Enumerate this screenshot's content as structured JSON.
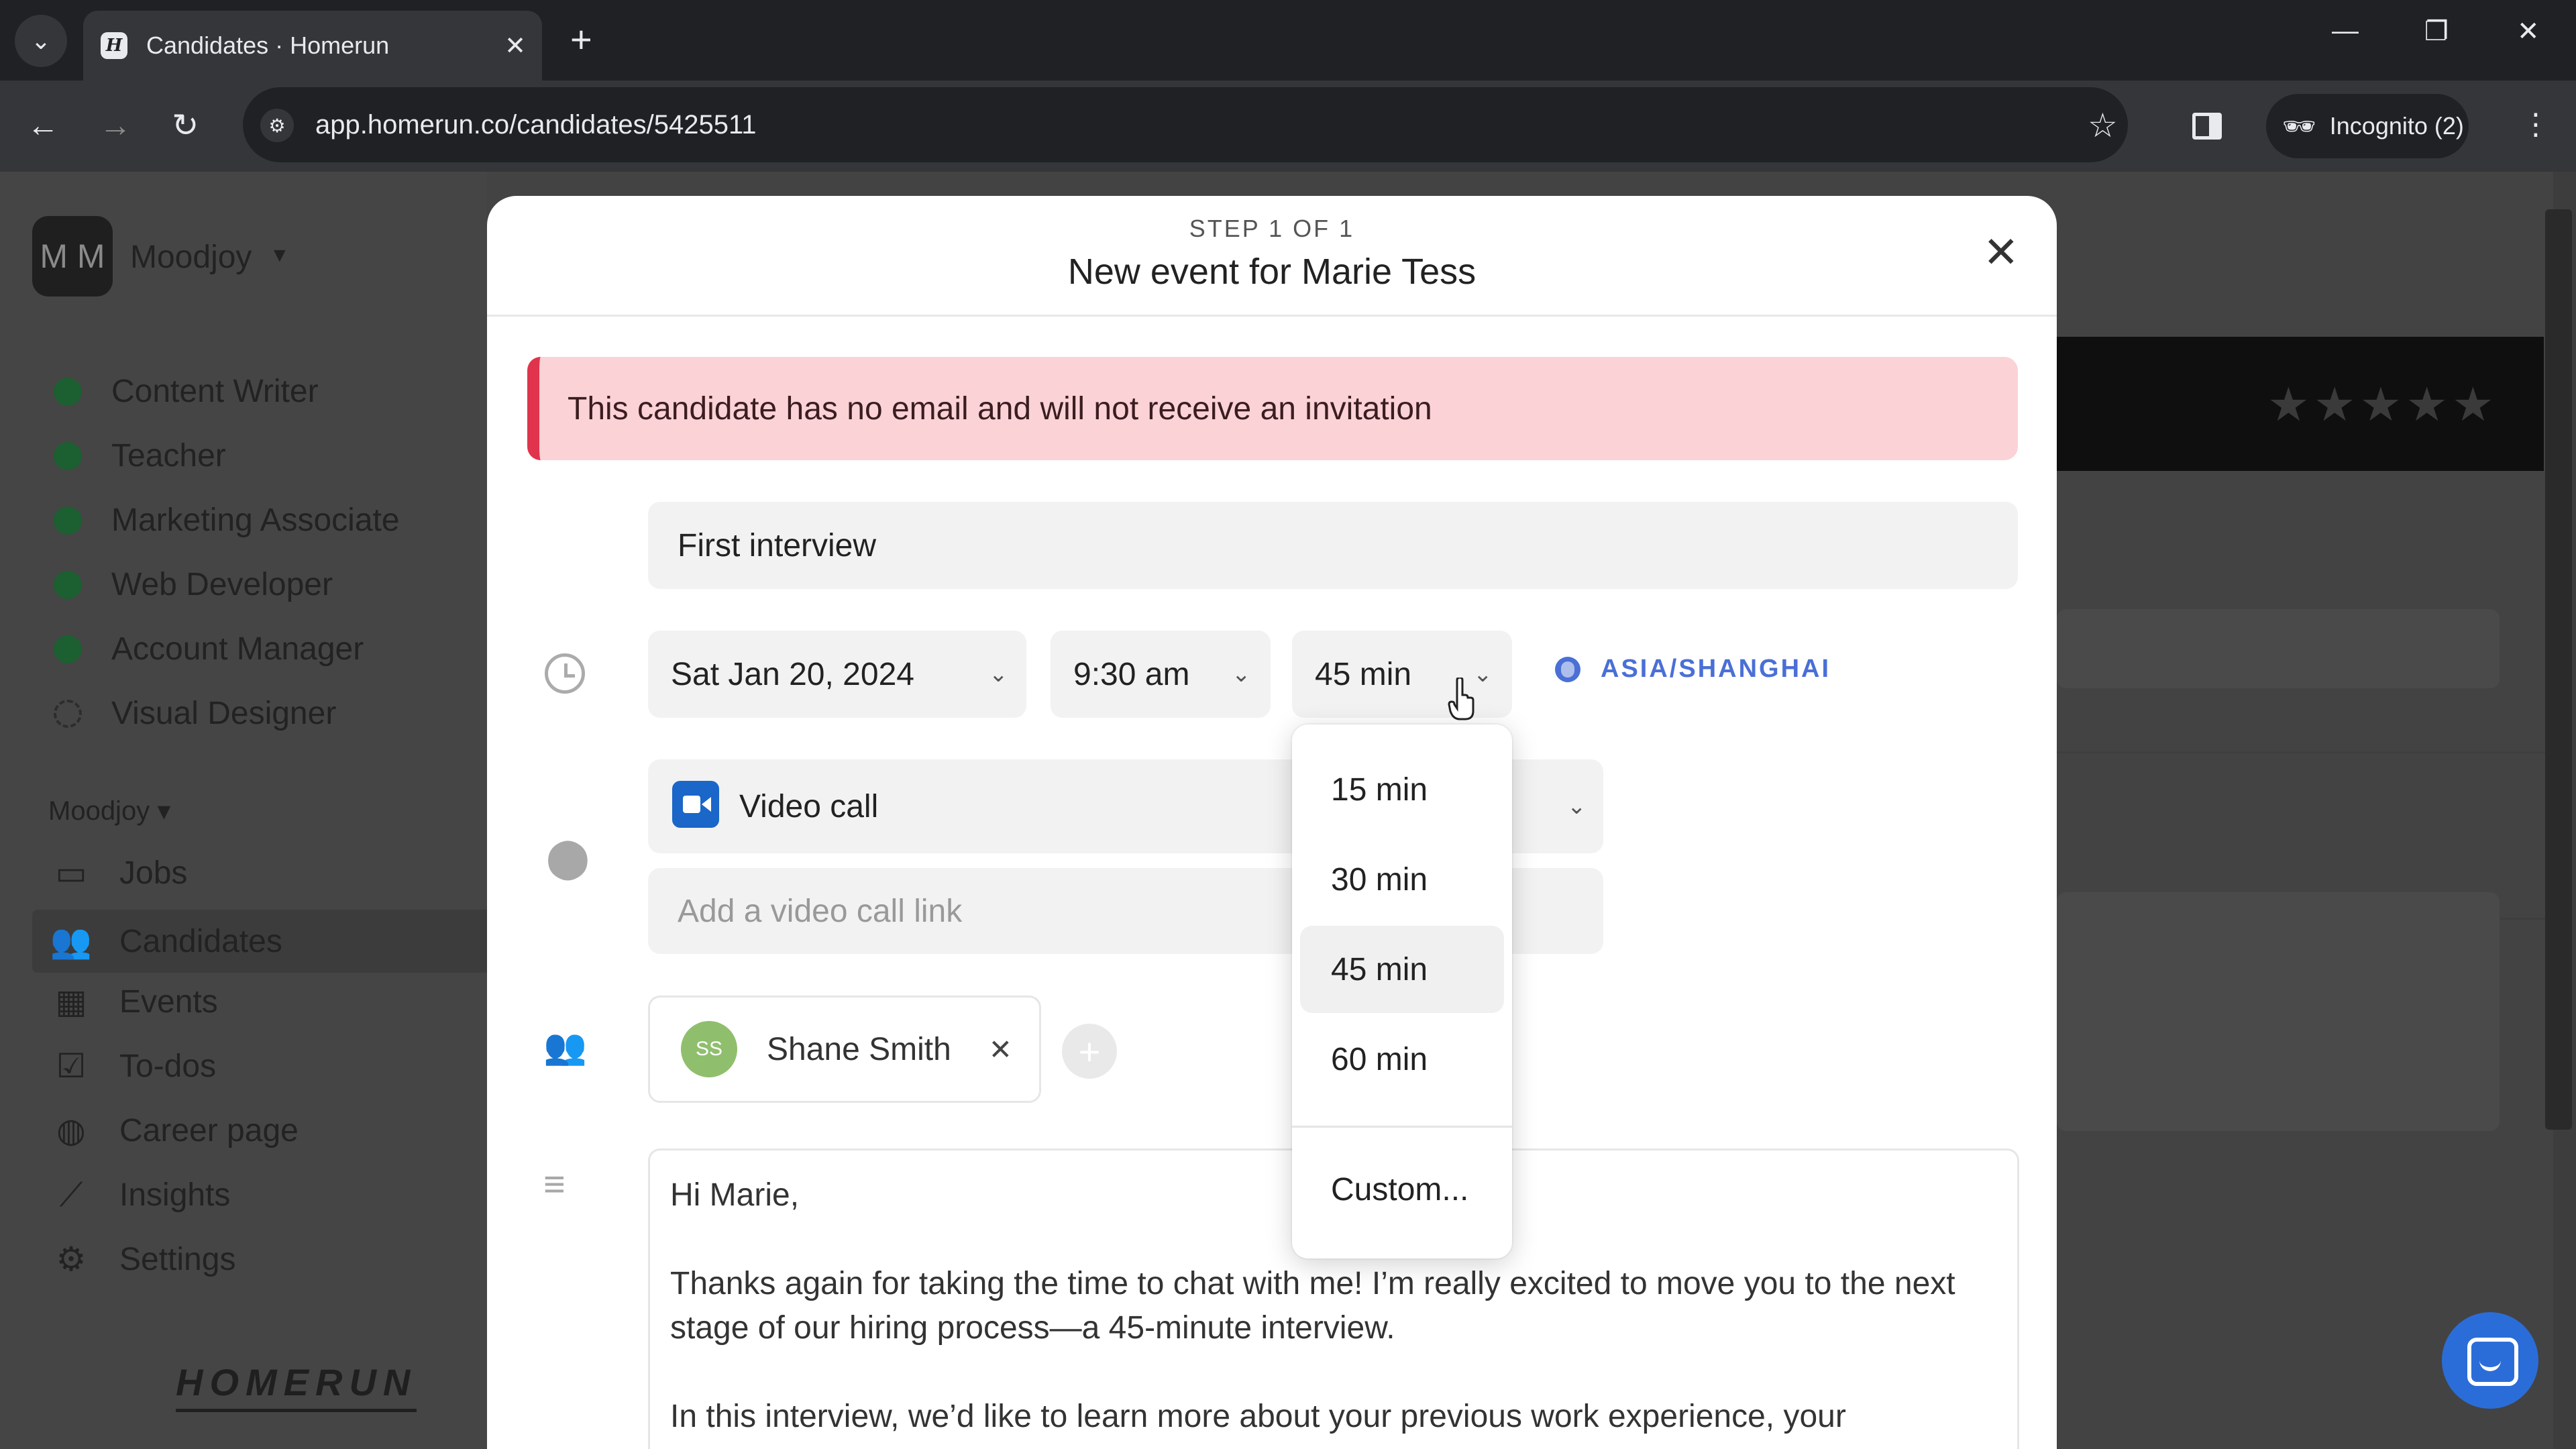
{
  "browser": {
    "tab_title": "Candidates · Homerun",
    "favicon_letter": "H",
    "url": "app.homerun.co/candidates/5425511",
    "incognito_label": "Incognito (2)"
  },
  "sidebar": {
    "workspace_initials": "M M",
    "workspace_name": "Moodjoy",
    "jobs": [
      {
        "label": "Content Writer",
        "status": "active"
      },
      {
        "label": "Teacher",
        "status": "active"
      },
      {
        "label": "Marketing Associate",
        "status": "active"
      },
      {
        "label": "Web Developer",
        "status": "active"
      },
      {
        "label": "Account Manager",
        "status": "active"
      },
      {
        "label": "Visual Designer",
        "status": "draft"
      }
    ],
    "section_label": "Moodjoy",
    "nav": [
      {
        "label": "Jobs",
        "icon": "briefcase-icon"
      },
      {
        "label": "Candidates",
        "icon": "people-icon",
        "active": true
      },
      {
        "label": "Events",
        "icon": "calendar-icon"
      },
      {
        "label": "To-dos",
        "icon": "checkbox-icon"
      },
      {
        "label": "Career page",
        "icon": "globe-icon"
      },
      {
        "label": "Insights",
        "icon": "chart-line-icon"
      },
      {
        "label": "Settings",
        "icon": "gear-icon"
      }
    ],
    "brand_logo": "HOMERUN"
  },
  "modal": {
    "step": "STEP 1 OF 1",
    "title": "New event for Marie Tess",
    "alert": "This candidate has no email and will not receive an invitation",
    "event_name": "First interview",
    "date": "Sat Jan 20, 2024",
    "time": "9:30 am",
    "duration": "45 min",
    "timezone": "ASIA/SHANGHAI",
    "location_type": "Video call",
    "video_link_placeholder": "Add a video call link",
    "attendee": {
      "initials": "SS",
      "name": "Shane Smith"
    },
    "message_greeting": "Hi Marie,",
    "message_p1": "Thanks again for taking the time to chat with me! I’m really excited to move you to the next stage of our hiring process—a 45-minute interview.",
    "message_p2": "In this interview, we’d like to learn more about your previous work experience, your"
  },
  "duration_dropdown": {
    "options": [
      "15 min",
      "30 min",
      "45 min",
      "60 min"
    ],
    "selected": "45 min",
    "custom": "Custom..."
  },
  "colors": {
    "alert_bg": "#fbd2d6",
    "alert_bar": "#e0344c",
    "timezone": "#4a6fd6",
    "video_badge": "#1a66c9",
    "attendee_avatar": "#8fbf6d",
    "job_active_dot": "#1c5f30",
    "help_button": "#2b6dd8"
  }
}
